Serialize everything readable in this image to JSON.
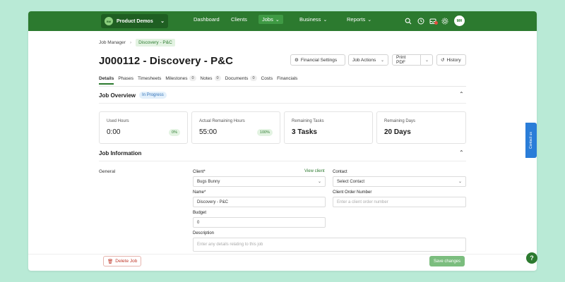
{
  "nav": {
    "org_logo_text": "BM",
    "org_name": "Product Demos",
    "items": [
      {
        "label": "Dashboard"
      },
      {
        "label": "Clients"
      },
      {
        "label": "Jobs"
      },
      {
        "label": "Business"
      },
      {
        "label": "Reports"
      }
    ],
    "avatar": "MH"
  },
  "breadcrumb": {
    "parent": "Job Manager",
    "current": "Discovery - P&C"
  },
  "page": {
    "title": "J000112 - Discovery - P&C"
  },
  "actions": {
    "financial_settings": "Financial Settings",
    "job_actions": "Job Actions",
    "print_pdf": "Print PDF",
    "history": "History"
  },
  "tabs": [
    {
      "label": "Details"
    },
    {
      "label": "Phases"
    },
    {
      "label": "Timesheets"
    },
    {
      "label": "Milestones",
      "count": "0"
    },
    {
      "label": "Notes",
      "count": "0"
    },
    {
      "label": "Documents",
      "count": "0"
    },
    {
      "label": "Costs"
    },
    {
      "label": "Financials"
    }
  ],
  "overview": {
    "title": "Job Overview",
    "status": "In Progress",
    "cards": [
      {
        "label": "Used Hours",
        "value": "0:00",
        "pill": "0%"
      },
      {
        "label": "Actual Remaining Hours",
        "value": "55:00",
        "pill": "100%"
      },
      {
        "label": "Remaining Tasks",
        "value": "3 Tasks"
      },
      {
        "label": "Remaining Days",
        "value": "20 Days"
      }
    ]
  },
  "info": {
    "title": "Job Information",
    "group_label": "General",
    "client_label": "Client*",
    "view_client": "View client",
    "client_value": "Bugs Bunny",
    "name_label": "Name*",
    "name_value": "Discovery - P&C",
    "budget_label": "Budget",
    "budget_value": "0",
    "description_label": "Description",
    "description_placeholder": "Enter any details relating to this job",
    "contact_label": "Contact",
    "contact_value": "Select Contact",
    "order_label": "Client Order Number",
    "order_placeholder": "Enter a client order number"
  },
  "footer": {
    "delete": "Delete Job",
    "save": "Save changes"
  },
  "side": {
    "contact_us": "Contact us",
    "help": "?"
  },
  "colors": {
    "brand": "#2c7a2f",
    "background": "#b9ead6",
    "status_blue": "#3271b7",
    "danger": "#c0392b"
  }
}
